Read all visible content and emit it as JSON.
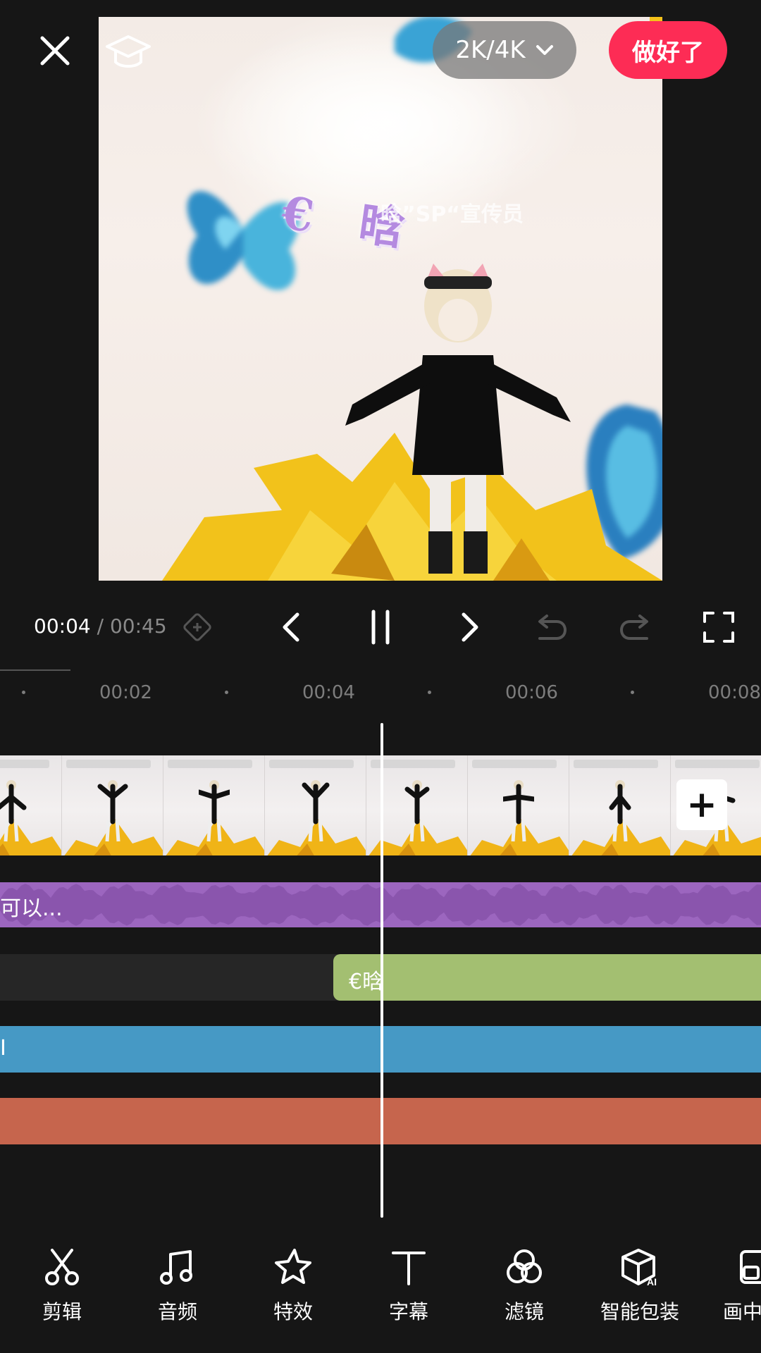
{
  "header": {
    "resolution_label": "2K/4K",
    "done_label": "做好了"
  },
  "preview": {
    "overlay_text_large": "€ 晗",
    "overlay_text_small": "晗”SP“宣传员"
  },
  "player": {
    "current_time": "00:04",
    "separator": "/",
    "total_time": "00:45"
  },
  "timeline": {
    "ruler_ticks": [
      "00:02",
      "00:04",
      "00:06",
      "00:08"
    ],
    "audio_clip_label": "可以...",
    "text_clip_label": "€晗",
    "blue_clip_label": "I"
  },
  "toolbar": {
    "items": [
      {
        "label": "剪辑",
        "icon": "scissors-icon"
      },
      {
        "label": "音频",
        "icon": "music-note-icon"
      },
      {
        "label": "特效",
        "icon": "sparkle-star-icon"
      },
      {
        "label": "字幕",
        "icon": "text-t-icon"
      },
      {
        "label": "滤镜",
        "icon": "filter-circles-icon"
      },
      {
        "label": "智能包装",
        "icon": "ai-box-icon"
      },
      {
        "label": "画中",
        "icon": "picture-in-picture-icon"
      }
    ]
  },
  "colors": {
    "background": "#161616",
    "done_button": "#fd2c55",
    "audio_track": "#9c66bf",
    "text_track": "#a3bf71",
    "blue_track": "#4699c5",
    "red_track": "#c6654d"
  }
}
